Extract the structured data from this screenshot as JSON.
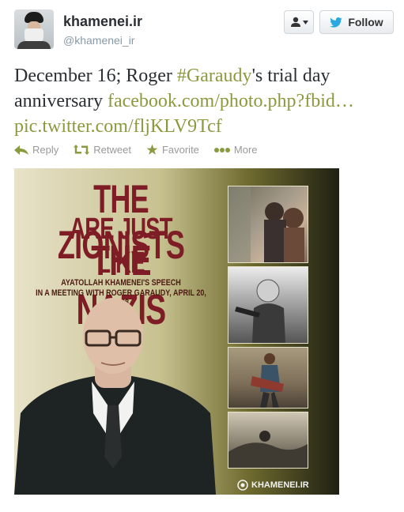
{
  "header": {
    "name": "khamenei.ir",
    "handle": "@khamenei_ir",
    "follow_label": "Follow",
    "user_menu_icon": "user-silhouette-icon",
    "follow_icon": "twitter-bird-icon"
  },
  "tweet": {
    "text_before": "December 16; Roger ",
    "hashtag": "#Garaudy",
    "text_after": "'s trial day anniversary ",
    "link": "facebook.com/photo.php?fbid…",
    "pic_link": "pic.twitter.com/fljKLV9Tcf"
  },
  "actions": {
    "reply": "Reply",
    "retweet": "Retweet",
    "favorite": "Favorite",
    "more": "More"
  },
  "poster": {
    "title_line1": "THE ZIONISTS",
    "title_line2": "ARE JUST LIKE",
    "title_line3": "THE NAZIS",
    "subtitle_line1": "AYATOLLAH KHAMENEI'S SPEECH",
    "subtitle_line2": "IN A MEETING WITH ROGER GARAUDY, APRIL 20, 1998",
    "logo_text": "KHAMENEI.IR"
  },
  "colors": {
    "link": "#8a9a3e",
    "title_red": "#7e1d26",
    "action_gray": "#999999",
    "follow_bird": "#2aa9e0"
  }
}
